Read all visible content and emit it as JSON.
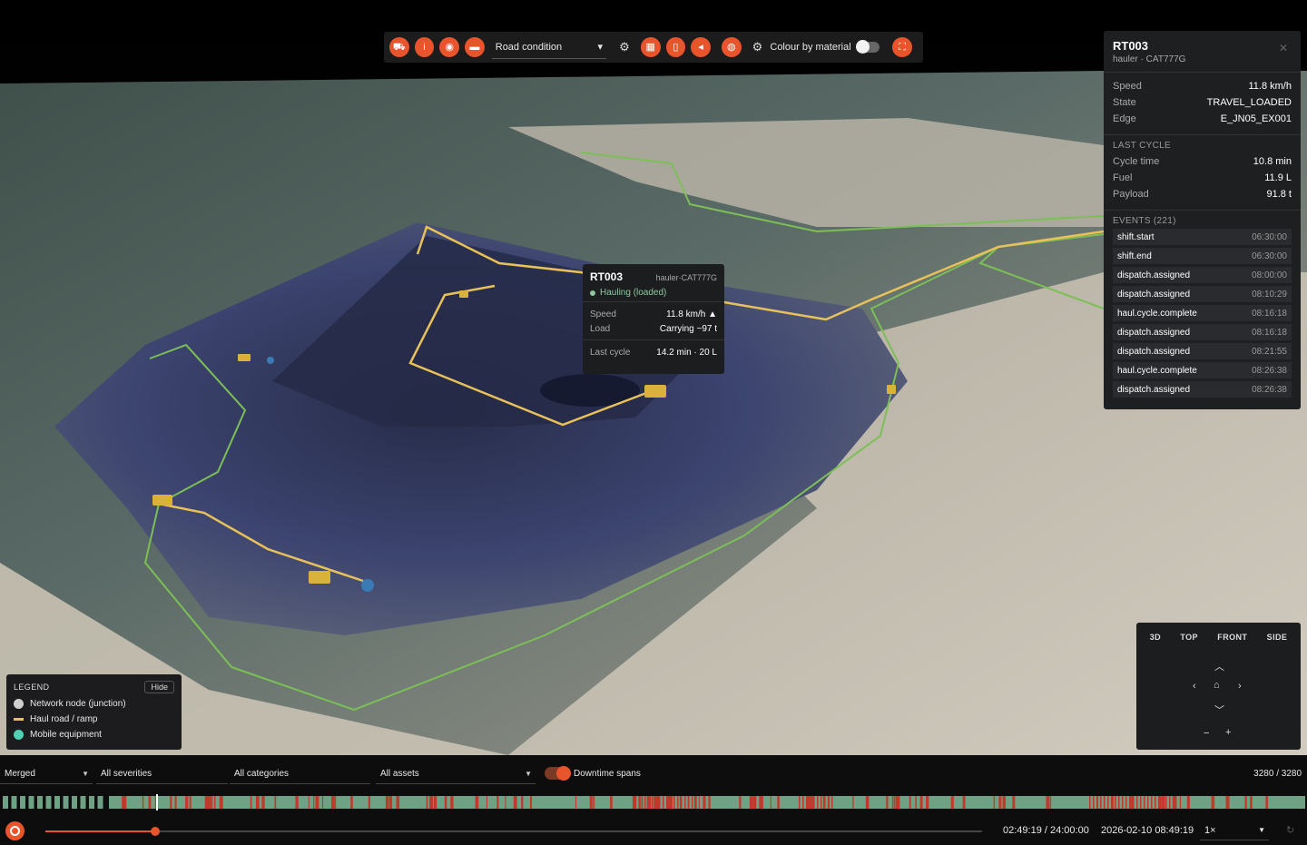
{
  "toolbar": {
    "buttons": [
      "car-icon",
      "info-icon",
      "eye-icon",
      "tag-icon"
    ],
    "road_select": "Road condition",
    "buttons2": [
      "grid-icon",
      "map-icon",
      "marker-icon"
    ],
    "buttons3": [
      "globe-icon"
    ],
    "colour_label": "Colour by material",
    "colour_enabled": false
  },
  "info_panel": {
    "title": "RT003",
    "subtitle": "hauler · CAT777G",
    "speed_label": "Speed",
    "speed_value": "11.8 km/h",
    "state_label": "State",
    "state_value": "TRAVEL_LOADED",
    "edge_label": "Edge",
    "edge_value": "E_JN05_EX001",
    "last_cycle_heading": "LAST CYCLE",
    "cycle_label": "Cycle time",
    "cycle_value": "10.8 min",
    "fuel_label": "Fuel",
    "fuel_value": "11.9 L",
    "payload_label": "Payload",
    "payload_value": "91.8 t",
    "events_heading": "EVENTS (221)",
    "events": [
      {
        "name": "shift.start",
        "time": "06:30:00"
      },
      {
        "name": "shift.end",
        "time": "06:30:00"
      },
      {
        "name": "dispatch.assigned",
        "time": "08:00:00"
      },
      {
        "name": "dispatch.assigned",
        "time": "08:10:29"
      },
      {
        "name": "haul.cycle.complete",
        "time": "08:16:18"
      },
      {
        "name": "dispatch.assigned",
        "time": "08:16:18"
      },
      {
        "name": "dispatch.assigned",
        "time": "08:21:55"
      },
      {
        "name": "haul.cycle.complete",
        "time": "08:26:38"
      },
      {
        "name": "dispatch.assigned",
        "time": "08:26:38"
      }
    ]
  },
  "tooltip": {
    "id": "RT003",
    "model": "hauler·CAT777G",
    "status": "Hauling (loaded)",
    "speed_label": "Speed",
    "speed_value": "11.8 km/h ▲",
    "load_label": "Load",
    "load_value": "Carrying ~97 t",
    "cycle_label": "Last cycle",
    "cycle_value": "14.2 min · 20 L"
  },
  "legend": {
    "title": "LEGEND",
    "hide_label": "Hide",
    "items": [
      {
        "label": "Network node (junction)",
        "color": "#cfcfcf"
      },
      {
        "label": "Haul road / ramp",
        "color": "#e8c15a"
      },
      {
        "label": "Mobile equipment",
        "color": "#4fd1b4"
      }
    ]
  },
  "view_nav": {
    "tabs": [
      "3D",
      "TOP",
      "FRONT",
      "SIDE"
    ]
  },
  "filters": {
    "mode": "Merged",
    "severities": "All severities",
    "categories": "All categories",
    "assets": "All assets",
    "downtime_label": "Downtime spans",
    "downtime_enabled": true,
    "count": "3280 / 3280"
  },
  "playback": {
    "time": "02:49:19 / 24:00:00",
    "datetime": "2026-02-10 08:49:19",
    "speed": "1×",
    "progress": 0.117
  },
  "colors": {
    "accent": "#e8542c",
    "haul_road": "#e8c15a",
    "network": "#7cbf57",
    "ok_span": "#6fa184",
    "down_span": "#c0392b"
  }
}
